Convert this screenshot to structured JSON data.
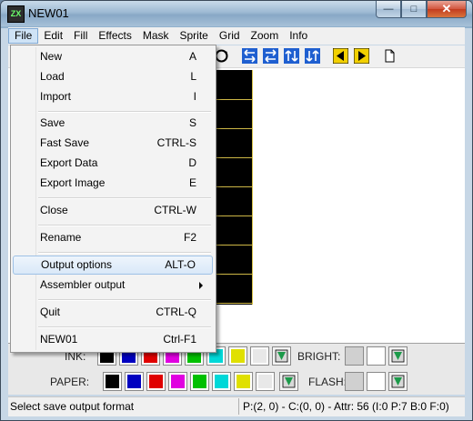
{
  "window": {
    "title": "NEW01"
  },
  "menubar": [
    "File",
    "Edit",
    "Fill",
    "Effects",
    "Mask",
    "Sprite",
    "Grid",
    "Zoom",
    "Info"
  ],
  "file_menu": {
    "items": [
      {
        "label": "New",
        "shortcut": "A"
      },
      {
        "label": "Load",
        "shortcut": "L"
      },
      {
        "label": "Import",
        "shortcut": "I"
      },
      {
        "label": "Save",
        "shortcut": "S"
      },
      {
        "label": "Fast Save",
        "shortcut": "CTRL-S"
      },
      {
        "label": "Export Data",
        "shortcut": "D"
      },
      {
        "label": "Export Image",
        "shortcut": "E"
      },
      {
        "label": "Close",
        "shortcut": "CTRL-W"
      },
      {
        "label": "Rename",
        "shortcut": "F2"
      },
      {
        "label": "Output options",
        "shortcut": "ALT-O"
      },
      {
        "label": "Assembler output",
        "shortcut": ""
      },
      {
        "label": "Quit",
        "shortcut": "CTRL-Q"
      },
      {
        "label": "NEW01",
        "shortcut": "Ctrl-F1"
      }
    ]
  },
  "toolbar": {
    "icons": [
      "rotate-icon",
      "shift-left-icon",
      "shift-right-icon",
      "shift-up-icon",
      "shift-down-icon",
      "prev-frame-icon",
      "next-frame-icon",
      "new-page-icon"
    ]
  },
  "palette": {
    "ink_label": "INK:",
    "paper_label": "PAPER:",
    "bright_label": "BRIGHT:",
    "flash_label": "FLASH:",
    "colors": [
      "#000000",
      "#0000c0",
      "#e00000",
      "#e000e0",
      "#00c000",
      "#00d8d8",
      "#e0e000",
      "#e8e8e8"
    ],
    "ink_colors": [
      "#000000",
      "#0000c0",
      "#e00000",
      "#e000e0",
      "#00c000",
      "#00d8d8",
      "#e0e000",
      "#e8e8e8"
    ]
  },
  "status": {
    "left": "Select save output format",
    "right": "P:(2, 0) - C:(0, 0) - Attr: 56 (I:0 P:7 B:0 F:0)"
  }
}
